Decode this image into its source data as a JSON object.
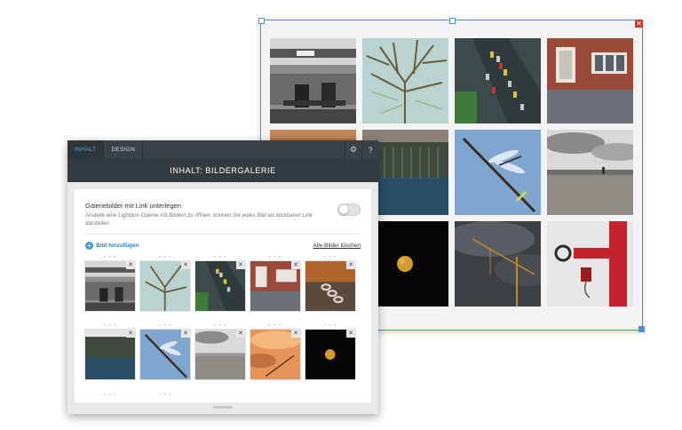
{
  "editor": {
    "tabs": [
      {
        "label": "INHALT",
        "active": true
      },
      {
        "label": "DESIGN",
        "active": false
      }
    ],
    "tools": {
      "settings_icon": "gear-icon",
      "help_label": "?"
    },
    "title": "INHALT: BILDERGALERIE",
    "option": {
      "title": "Galeriebilder mit Link unterlegen",
      "description": "Anstelle eine Lightbox-Galerie mit Bildern zu öffnen, können Sie jedes Bild als klickbaren Link darstellen.",
      "enabled": false
    },
    "add_image_label": "Bild hinzufügen",
    "clear_all_label": "Alle Bilder löschen",
    "remove_glyph": "✕",
    "drag_glyph": "• • •"
  },
  "gallery": {
    "close_glyph": "✕"
  },
  "colors": {
    "accent": "#3a9ad9",
    "panel_dark": "#333b41",
    "selection_border": "#4a90d9",
    "close_red": "#d9342b"
  }
}
